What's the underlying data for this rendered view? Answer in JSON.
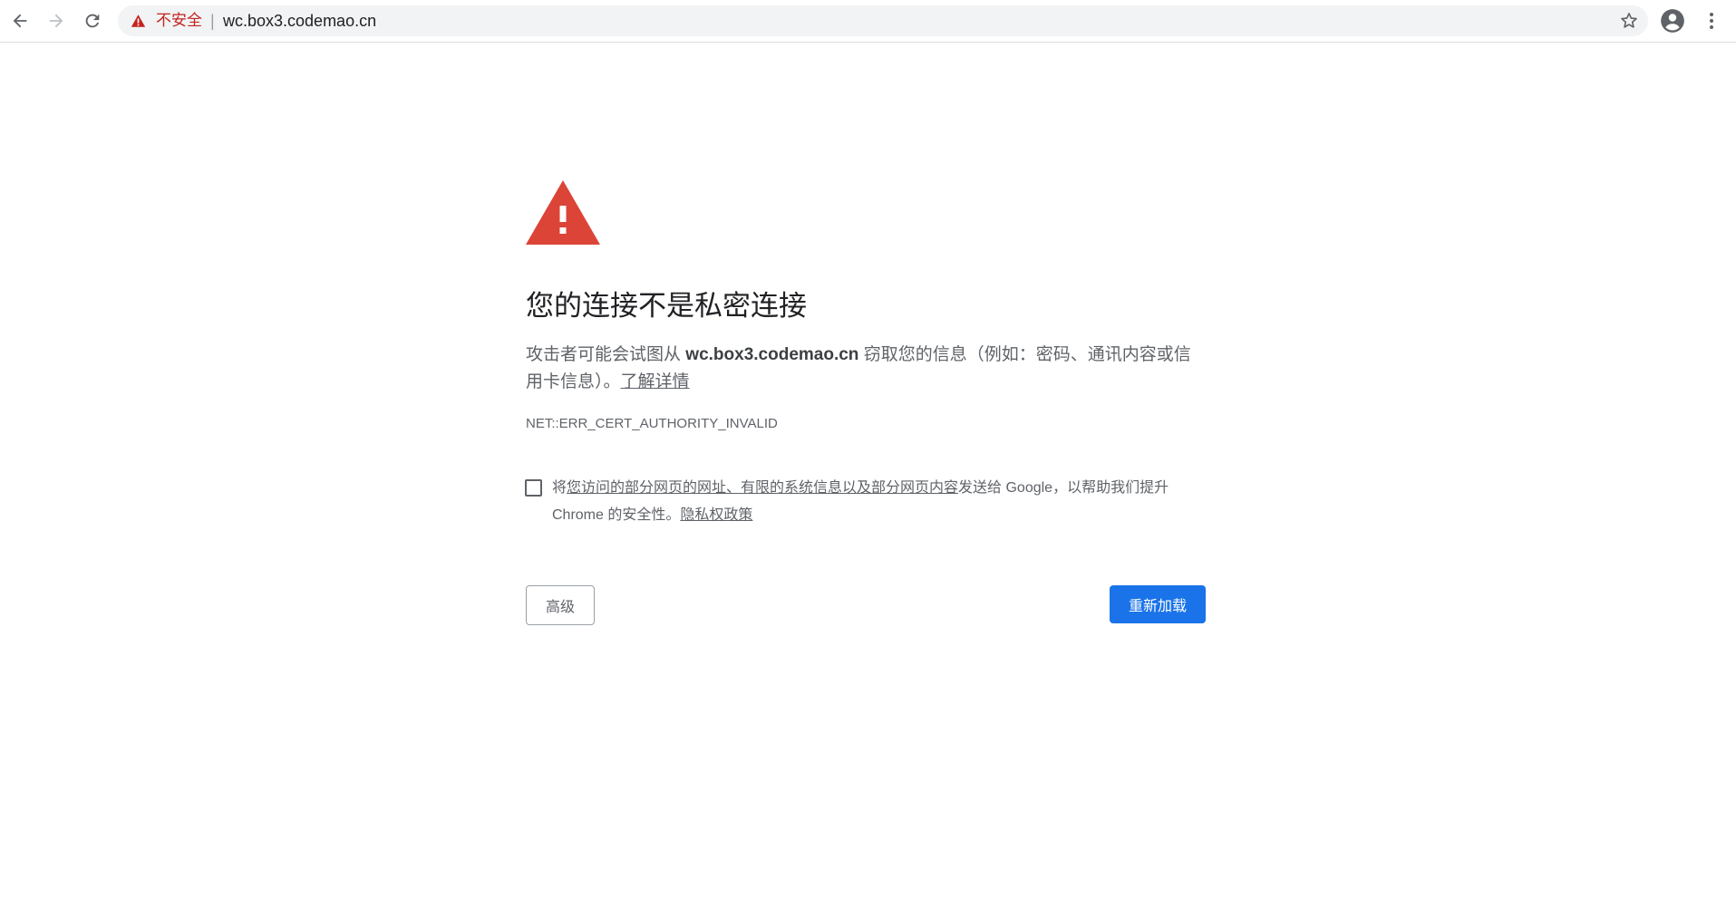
{
  "toolbar": {
    "back_icon": "arrow-left-icon",
    "forward_icon": "arrow-right-icon",
    "reload_icon": "reload-icon",
    "security_label": "不安全",
    "separator": "|",
    "url": "wc.box3.codemao.cn",
    "bookmark_icon": "star-icon",
    "profile_icon": "account-icon",
    "menu_icon": "vertical-dots-icon"
  },
  "interstitial": {
    "title": "您的连接不是私密连接",
    "desc_prefix": "攻击者可能会试图从",
    "desc_host": "wc.box3.codemao.cn",
    "desc_suffix": "窃取您的信息（例如：密码、通讯内容或信用卡信息）。",
    "learn_more": "了解详情",
    "error_code": "NET::ERR_CERT_AUTHORITY_INVALID",
    "optin_prefix": "将",
    "optin_link": "您访问的部分网页的网址、有限的系统信息以及部分网页内容",
    "optin_middle": "发送给 Google，以帮助我们提升 Chrome 的安全性。",
    "privacy_link": "隐私权政策",
    "advanced_button": "高级",
    "reload_button": "重新加载"
  },
  "colors": {
    "warning_red": "#db4437",
    "insecure_text": "#c5221f",
    "primary_blue": "#1a73e8"
  }
}
